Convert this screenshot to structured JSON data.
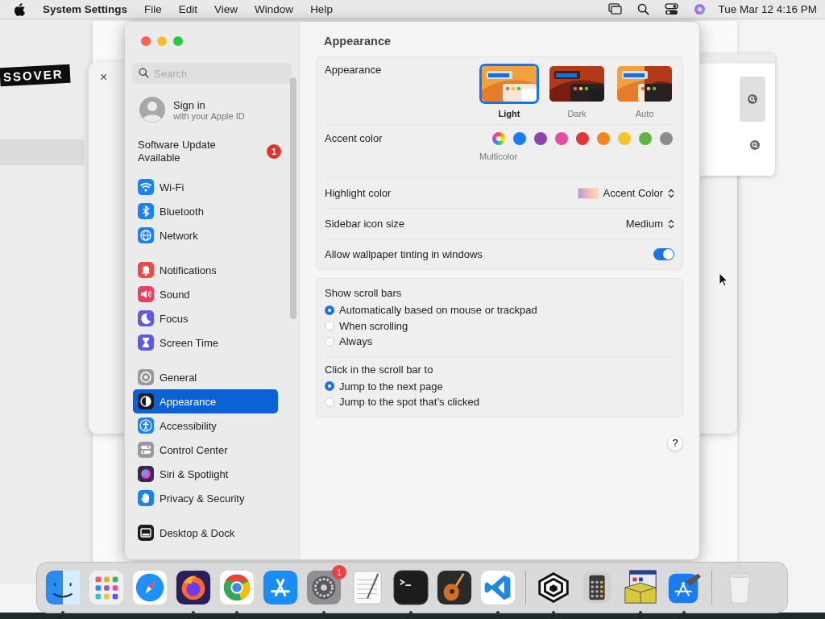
{
  "menubar": {
    "app": "System Settings",
    "menus": [
      "File",
      "Edit",
      "View",
      "Window",
      "Help"
    ],
    "clock": "Tue Mar 12  4:16 PM"
  },
  "background": {
    "banner": "SSOVER",
    "close": "×"
  },
  "window": {
    "title": "Appearance"
  },
  "sidebar": {
    "search": {
      "placeholder": "Search"
    },
    "account": {
      "title": "Sign in",
      "subtitle": "with your Apple ID"
    },
    "update": {
      "label": "Software Update Available",
      "badge": "1"
    },
    "groups": [
      [
        {
          "label": "Wi-Fi",
          "kind": "wifi",
          "color": "#1a82f7",
          "selected": false
        },
        {
          "label": "Bluetooth",
          "kind": "bluetooth",
          "color": "#1a82f7",
          "selected": false
        },
        {
          "label": "Network",
          "kind": "globe",
          "color": "#1a82f7",
          "selected": false
        }
      ],
      [
        {
          "label": "Notifications",
          "kind": "bell",
          "color": "#ec4a45",
          "selected": false
        },
        {
          "label": "Sound",
          "kind": "speaker",
          "color": "#ee3c62",
          "selected": false
        },
        {
          "label": "Focus",
          "kind": "moon",
          "color": "#5e5ce6",
          "selected": false
        },
        {
          "label": "Screen Time",
          "kind": "hourglass",
          "color": "#5e5ce6",
          "selected": false
        }
      ],
      [
        {
          "label": "General",
          "kind": "gear",
          "color": "#9a9a9e",
          "selected": false
        },
        {
          "label": "Appearance",
          "kind": "halfcircle",
          "color": "#1c1c1e",
          "selected": true
        },
        {
          "label": "Accessibility",
          "kind": "person",
          "color": "#1a82f7",
          "selected": false
        },
        {
          "label": "Control Center",
          "kind": "toggles",
          "color": "#9a9a9e",
          "selected": false
        },
        {
          "label": "Siri & Spotlight",
          "kind": "orb",
          "color": "#3a2a4a",
          "selected": false
        },
        {
          "label": "Privacy & Security",
          "kind": "hand",
          "color": "#1a82f7",
          "selected": false
        }
      ],
      [
        {
          "label": "Desktop & Dock",
          "kind": "dock",
          "color": "#1c1c1e",
          "selected": false
        }
      ]
    ]
  },
  "appearance": {
    "label": "Appearance",
    "options": [
      {
        "label": "Light",
        "kind": "light",
        "selected": true
      },
      {
        "label": "Dark",
        "kind": "dark",
        "selected": false
      },
      {
        "label": "Auto",
        "kind": "auto",
        "selected": false
      }
    ]
  },
  "accent": {
    "label": "Accent color",
    "caption": "Multicolor",
    "colors": [
      {
        "kind": "multicolor",
        "selected": true
      },
      {
        "kind": "solid",
        "color": "#1b7cf5",
        "selected": false
      },
      {
        "kind": "solid",
        "color": "#8e44ad",
        "selected": false
      },
      {
        "kind": "solid",
        "color": "#e84c9f",
        "selected": false
      },
      {
        "kind": "solid",
        "color": "#e0373a",
        "selected": false
      },
      {
        "kind": "solid",
        "color": "#f5871f",
        "selected": false
      },
      {
        "kind": "solid",
        "color": "#f7c325",
        "selected": false
      },
      {
        "kind": "solid",
        "color": "#5db543",
        "selected": false
      },
      {
        "kind": "solid",
        "color": "#8c8c8c",
        "selected": false
      }
    ]
  },
  "highlight": {
    "label": "Highlight color",
    "value": "Accent Color"
  },
  "icon_size": {
    "label": "Sidebar icon size",
    "value": "Medium"
  },
  "tinting": {
    "label": "Allow wallpaper tinting in windows",
    "on": true
  },
  "radio_groups": [
    {
      "title": "Show scroll bars",
      "options": [
        {
          "label": "Automatically based on mouse or trackpad",
          "selected": true
        },
        {
          "label": "When scrolling",
          "selected": false
        },
        {
          "label": "Always",
          "selected": false
        }
      ]
    },
    {
      "title": "Click in the scroll bar to",
      "options": [
        {
          "label": "Jump to the next page",
          "selected": true
        },
        {
          "label": "Jump to the spot that’s clicked",
          "selected": false
        }
      ]
    }
  ],
  "help": "?",
  "dock": {
    "sections": [
      [
        {
          "kind": "finder",
          "running": true
        },
        {
          "kind": "launchpad",
          "running": false
        },
        {
          "kind": "safari",
          "running": false
        },
        {
          "kind": "firefox",
          "running": true
        },
        {
          "kind": "chrome",
          "running": true
        },
        {
          "kind": "appstore",
          "running": false
        },
        {
          "kind": "settings",
          "running": true,
          "badge": "1"
        },
        {
          "kind": "textedit",
          "running": false
        },
        {
          "kind": "terminal",
          "running": true
        },
        {
          "kind": "guitar",
          "running": false
        },
        {
          "kind": "vscode",
          "running": true
        }
      ],
      [
        {
          "kind": "cube",
          "running": true
        },
        {
          "kind": "calculator",
          "running": false
        },
        {
          "kind": "winebox",
          "running": true
        },
        {
          "kind": "xcode",
          "running": true
        }
      ],
      [
        {
          "kind": "trash",
          "running": false
        }
      ]
    ]
  }
}
